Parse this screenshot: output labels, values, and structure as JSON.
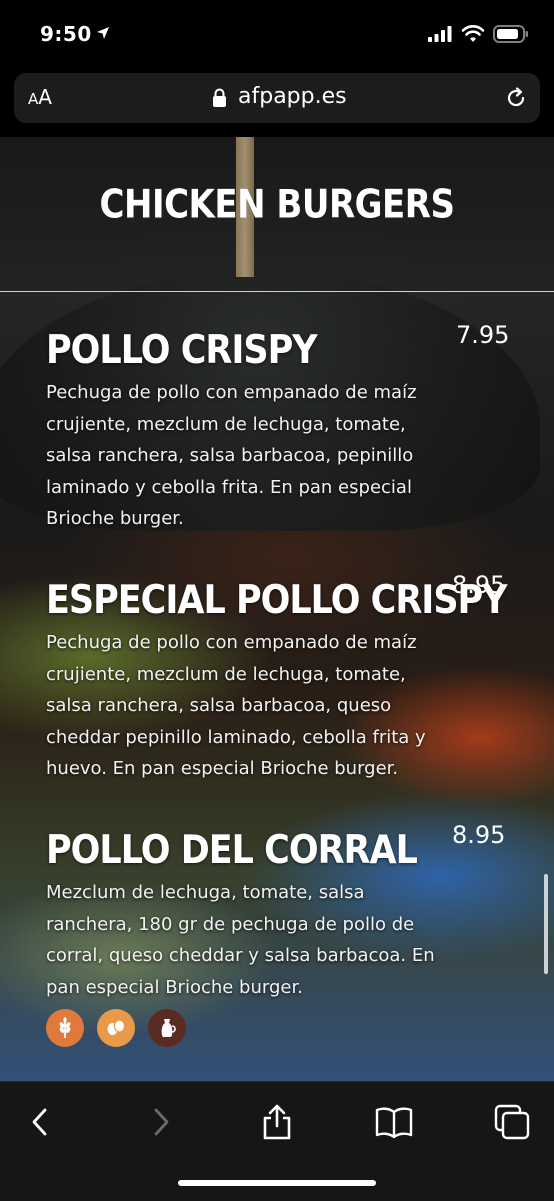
{
  "status_bar": {
    "time": "9:50",
    "icons": [
      "location-arrow-icon",
      "cellular-signal-icon",
      "wifi-icon",
      "battery-icon"
    ]
  },
  "browser": {
    "text_size_label_small": "A",
    "text_size_label_large": "A",
    "url": "afpapp.es",
    "icons": [
      "lock-icon",
      "reload-icon"
    ]
  },
  "menu": {
    "section_title": "Chicken Burgers",
    "items": [
      {
        "name": "Pollo Crispy",
        "price": "7.95",
        "description": "Pechuga de pollo con empanado de maíz crujiente, mezclum de lechuga, tomate, salsa ranchera, salsa barbacoa, pepinillo laminado y cebolla frita. En pan especial Brioche burger."
      },
      {
        "name": "Especial Pollo Crispy",
        "price": "8.95",
        "description": "Pechuga de pollo con empanado de maíz crujiente, mezclum de lechuga, tomate, salsa ranchera, salsa barbacoa, queso cheddar pepinillo laminado, cebolla frita y huevo. En pan especial Brioche burger."
      },
      {
        "name": "Pollo del Corral",
        "price": "8.95",
        "description": "Mezclum de lechuga, tomate, salsa ranchera, 180 gr de pechuga de pollo de corral, queso cheddar y salsa barbacoa. En pan especial Brioche burger."
      }
    ],
    "allergens": [
      {
        "icon": "gluten-wheat-icon",
        "color": "#e07a3c"
      },
      {
        "icon": "eggs-icon",
        "color": "#e89a4a"
      },
      {
        "icon": "milk-jug-icon",
        "color": "#5a2b22"
      }
    ]
  },
  "toolbar": {
    "icons": [
      "back-icon",
      "forward-icon",
      "share-icon",
      "bookmarks-icon",
      "tabs-icon"
    ]
  },
  "colors": {
    "background": "#000000",
    "toolbar": "#161616",
    "url_bar": "#1c1c1e",
    "text": "#ffffff"
  }
}
